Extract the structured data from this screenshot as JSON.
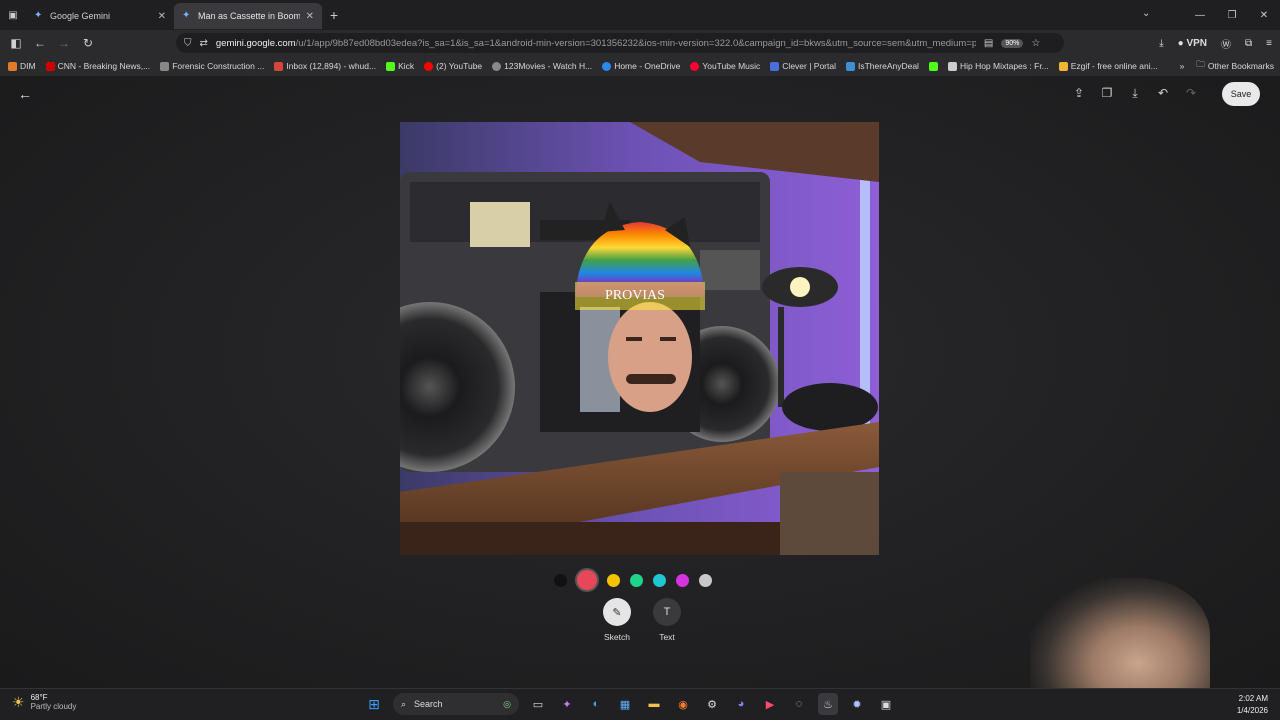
{
  "browser": {
    "tabs": [
      {
        "title": "Google Gemini",
        "active": false
      },
      {
        "title": "Man as Cassette in Boom Box",
        "active": true
      }
    ],
    "url_host": "gemini.google.com",
    "url_rest": "/u/1/app/9b87ed08bd03edea?is_sa=1&is_sa=1&android-min-version=301356232&ios-min-version=322.0&campaign_id=bkws&utm_source=sem&utm_medium=paid",
    "zoom": "90%",
    "vpn_label": "VPN",
    "bookmarks": [
      {
        "label": "DIM",
        "color": "#e07b2a"
      },
      {
        "label": "CNN - Breaking News,...",
        "color": "#cc0000"
      },
      {
        "label": "Forensic Construction ...",
        "color": "#888888"
      },
      {
        "label": "Inbox (12,894) - whud...",
        "color": "#d44638"
      },
      {
        "label": "Kick",
        "color": "#53fc18"
      },
      {
        "label": "(2) YouTube",
        "color": "#ff0000"
      },
      {
        "label": "123Movies - Watch H...",
        "color": "#888888"
      },
      {
        "label": "Home - OneDrive",
        "color": "#2a8af0"
      },
      {
        "label": "YouTube Music",
        "color": "#ff0033"
      },
      {
        "label": "Clever | Portal",
        "color": "#4a6ee0"
      },
      {
        "label": "IsThereAnyDeal",
        "color": "#3f8fd8"
      },
      {
        "label": "",
        "color": "#53fc18"
      },
      {
        "label": "Hip Hop Mixtapes : Fr...",
        "color": "#cccccc"
      },
      {
        "label": "Ezgif - free online ani...",
        "color": "#f2b632"
      }
    ],
    "other_bookmarks": "Other Bookmarks"
  },
  "editor": {
    "save_label": "Save",
    "colors": [
      "#111111",
      "#e8475a",
      "#f4c300",
      "#1fd38a",
      "#1ec8d0",
      "#d633e0",
      "#c8c8c8"
    ],
    "selected_color_index": 1,
    "tools": [
      {
        "label": "Sketch",
        "icon": "pencil-icon",
        "active": true
      },
      {
        "label": "Text",
        "icon": "text-icon",
        "active": false
      }
    ]
  },
  "taskbar": {
    "temp": "68°F",
    "condition": "Partly cloudy",
    "search_placeholder": "Search",
    "time": "2:02 AM",
    "date": "1/4/2026"
  }
}
